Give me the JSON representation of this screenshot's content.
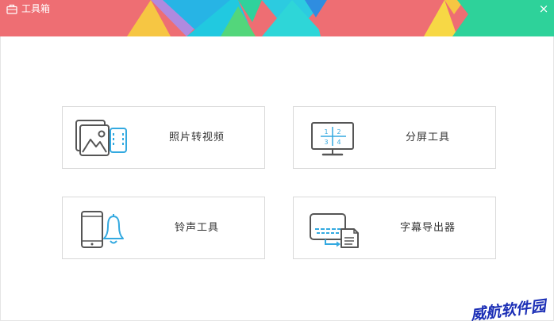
{
  "window": {
    "title": "工具箱",
    "close_glyph": "×",
    "accent": "#33a9e0"
  },
  "tools": [
    {
      "label": "照片转视频",
      "icon": "photo-to-video-icon"
    },
    {
      "label": "分屏工具",
      "icon": "split-screen-monitor-icon",
      "panel_numbers": [
        "1",
        "2",
        "3",
        "4"
      ]
    },
    {
      "label": "铃声工具",
      "icon": "ringtone-phone-bell-icon"
    },
    {
      "label": "字幕导出器",
      "icon": "subtitle-export-icon"
    }
  ],
  "watermark": {
    "text": "威航软件园"
  }
}
